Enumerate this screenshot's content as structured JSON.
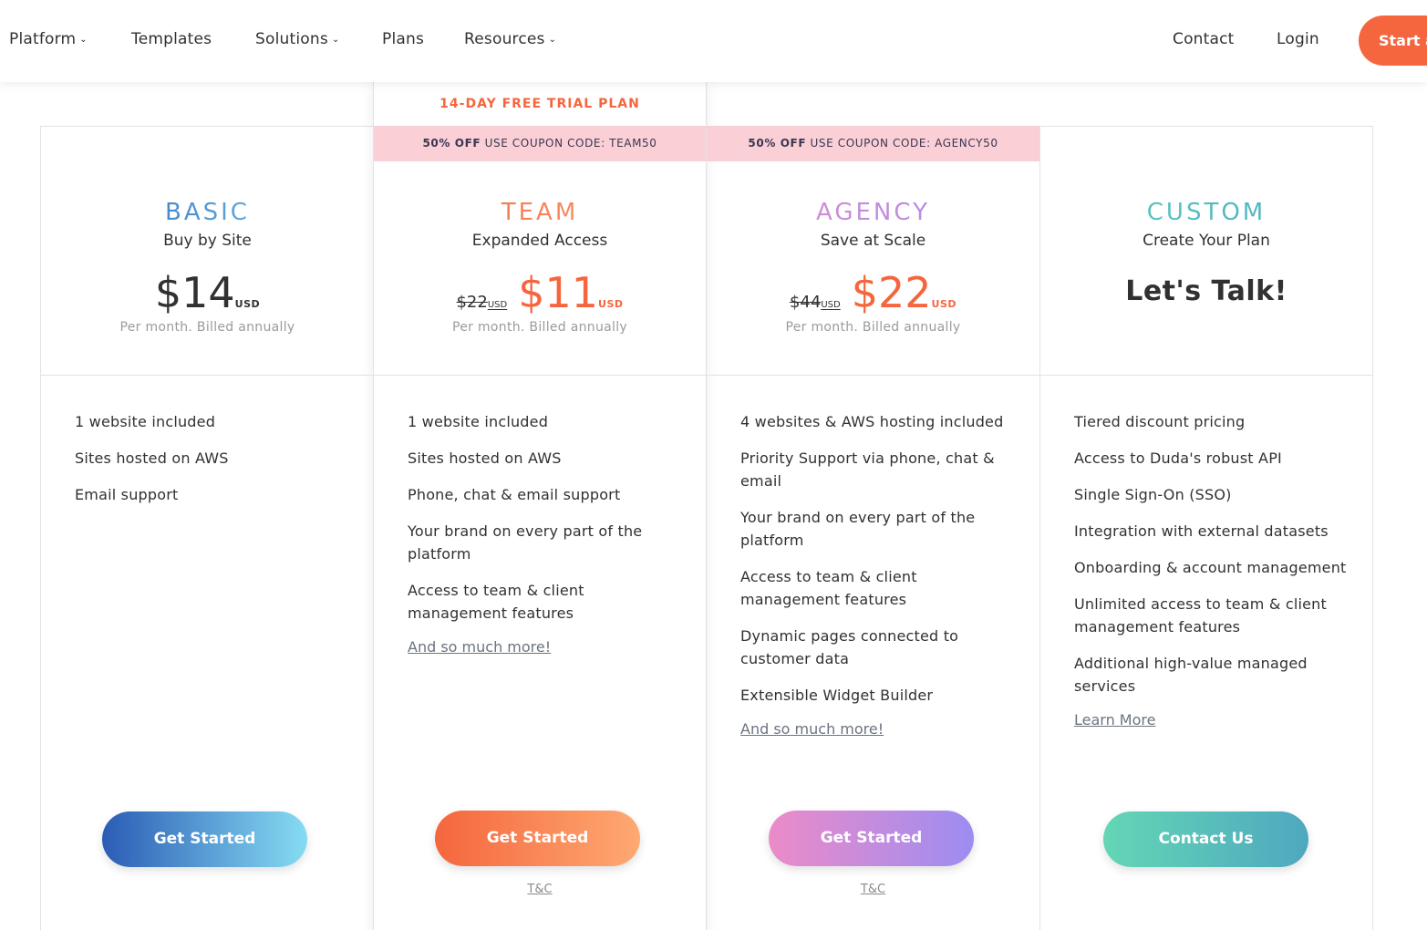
{
  "nav": {
    "items": [
      {
        "label": "Platform",
        "dropdown": true
      },
      {
        "label": "Templates",
        "dropdown": false
      },
      {
        "label": "Solutions",
        "dropdown": true
      },
      {
        "label": "Plans",
        "dropdown": false
      },
      {
        "label": "Resources",
        "dropdown": true
      }
    ],
    "contact": "Contact",
    "login": "Login",
    "start": "Start a",
    "caret_glyph": "⌄"
  },
  "colors": {
    "orange": "#f5663e",
    "coupon_bg": "#fad0d6"
  },
  "plans": [
    {
      "name": "BASIC",
      "subtitle": "Buy by Site",
      "price": "$14",
      "currency": "USD",
      "billing": "Per month. Billed annually",
      "features": [
        "1 website included",
        "Sites hosted on AWS",
        "Email support"
      ],
      "cta": "Get Started"
    },
    {
      "trial": "14-DAY FREE TRIAL PLAN",
      "coupon_bold": "50% OFF",
      "coupon_text": "USE COUPON CODE: TEAM50",
      "name": "TEAM",
      "subtitle": "Expanded Access",
      "old_price": "$22",
      "price": "$11",
      "currency": "USD",
      "billing": "Per month. Billed annually",
      "features": [
        "1 website included",
        "Sites hosted on AWS",
        "Phone, chat & email support",
        "Your brand on every part of the platform",
        "Access to team & client management features"
      ],
      "more": "And so much more!",
      "cta": "Get Started",
      "tc": "T&C"
    },
    {
      "coupon_bold": "50% OFF",
      "coupon_text": "USE COUPON CODE: AGENCY50",
      "name": "AGENCY",
      "subtitle": "Save at Scale",
      "old_price": "$44",
      "price": "$22",
      "currency": "USD",
      "billing": "Per month. Billed annually",
      "features": [
        "4 websites & AWS hosting included",
        "Priority Support via phone, chat & email",
        "Your brand on every part of the platform",
        "Access to team & client management features",
        "Dynamic pages connected to customer data",
        "Extensible Widget Builder"
      ],
      "more": "And so much more!",
      "cta": "Get Started",
      "tc": "T&C"
    },
    {
      "name": "CUSTOM",
      "subtitle": "Create Your Plan",
      "talk": "Let's Talk!",
      "features": [
        "Tiered discount pricing",
        "Access to Duda's robust API",
        "Single Sign-On (SSO)",
        "Integration with external datasets",
        "Onboarding & account management",
        "Unlimited access to team & client management features",
        "Additional high-value managed services"
      ],
      "more": "Learn More",
      "cta": "Contact Us"
    }
  ]
}
